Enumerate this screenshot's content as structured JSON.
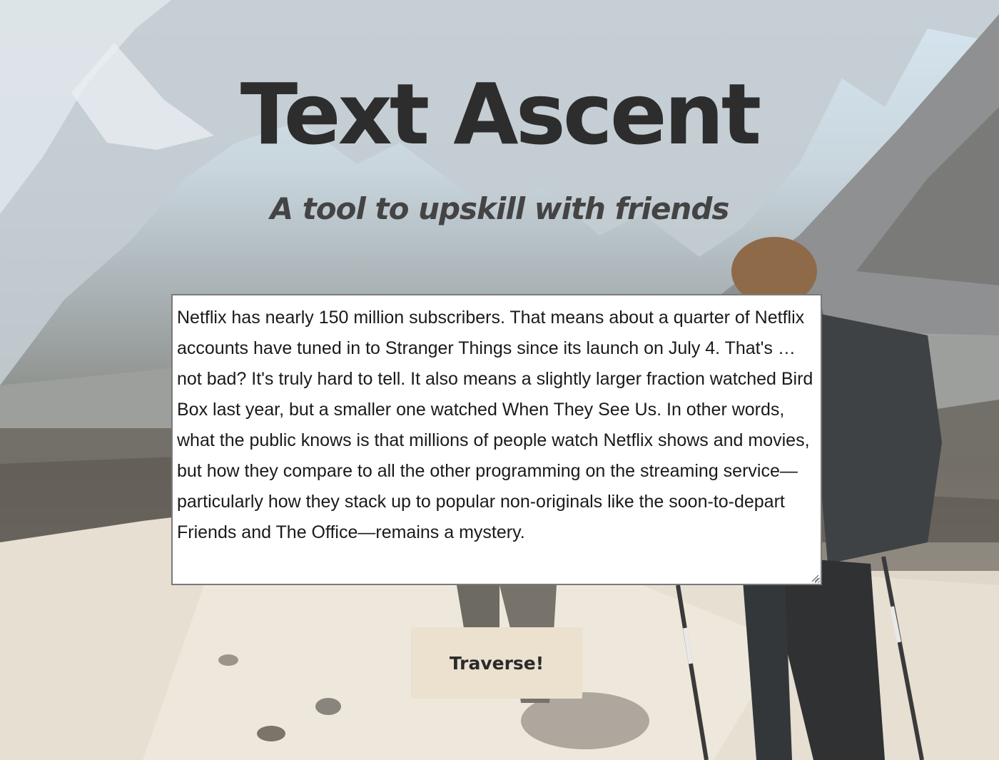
{
  "header": {
    "title": "Text Ascent",
    "subtitle": "A tool to upskill with friends"
  },
  "editor": {
    "value": "Netflix has nearly 150 million subscribers. That means about a quarter of Netflix accounts have tuned in to Stranger Things since its launch on July 4. That's … not bad? It's truly hard to tell. It also means a slightly larger fraction watched Bird Box last year, but a smaller one watched When They See Us. In other words, what the public knows is that millions of people watch Netflix shows and movies, but how they compare to all the other programming on the streaming service—particularly how they stack up to popular non-originals like the soon-to-depart Friends and The Office—remains a mystery."
  },
  "actions": {
    "traverse_label": "Traverse!"
  },
  "colors": {
    "title": "#2d2d2d",
    "subtitle": "#444444",
    "button_bg": "#ece0cf",
    "sky": "#d6e6f0"
  },
  "icons": {
    "resize_handle": "resize-grip-icon"
  }
}
